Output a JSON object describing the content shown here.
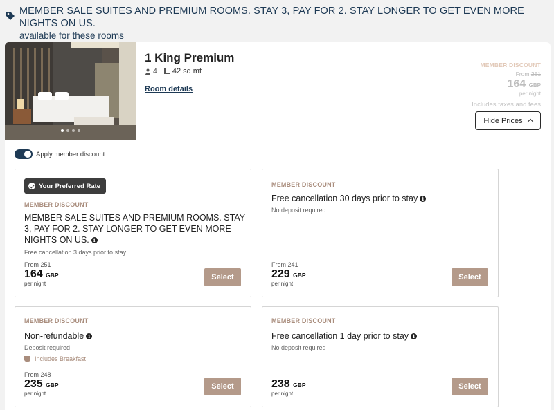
{
  "banner": {
    "icon": "tag-icon",
    "headline": "MEMBER SALE SUITES AND PREMIUM ROOMS. STAY 3, PAY FOR 2. STAY LONGER TO GET EVEN MORE NIGHTS ON US.",
    "subline": "available for these rooms"
  },
  "room": {
    "title": "1 King Premium",
    "guests": "4",
    "size": "42 sq mt",
    "details_link": "Room details",
    "carousel_dots": 4,
    "carousel_active": 1
  },
  "summary": {
    "label": "MEMBER DISCOUNT",
    "from_label": "From",
    "old_price": "251",
    "price": "164",
    "currency": "GBP",
    "per_night": "per night",
    "taxes_note": "Includes taxes and fees",
    "hide_prices": "Hide Prices"
  },
  "toggle": {
    "label": "Apply member discount",
    "on": true
  },
  "rates": [
    {
      "badge": "Your Preferred Rate",
      "discount_label": "MEMBER DISCOUNT",
      "title": "MEMBER SALE SUITES AND PREMIUM ROOMS. STAY 3, PAY FOR 2. STAY LONGER TO GET EVEN MORE NIGHTS ON US.",
      "sub": "Free cancellation 3 days prior to stay",
      "from_label": "From",
      "old_price": "251",
      "price": "164",
      "currency": "GBP",
      "per_night": "per night",
      "select": "Select"
    },
    {
      "discount_label": "MEMBER DISCOUNT",
      "title": "Free cancellation 30 days prior to stay",
      "sub": "No deposit required",
      "from_label": "From",
      "old_price": "241",
      "price": "229",
      "currency": "GBP",
      "per_night": "per night",
      "select": "Select"
    },
    {
      "discount_label": "MEMBER DISCOUNT",
      "title": "Non-refundable",
      "sub": "Deposit required",
      "perk": "Includes Breakfast",
      "from_label": "From",
      "old_price": "248",
      "price": "235",
      "currency": "GBP",
      "per_night": "per night",
      "select": "Select"
    },
    {
      "discount_label": "MEMBER DISCOUNT",
      "title": "Free cancellation 1 day prior to stay",
      "sub": "No deposit required",
      "price": "238",
      "currency": "GBP",
      "per_night": "per night",
      "select": "Select"
    }
  ],
  "colors": {
    "navy": "#1e3a55",
    "accent_tan": "#b49a8a",
    "discount_text": "#a98d7d",
    "badge_dark": "#3d3d3d",
    "page_bg": "#f2f2f2"
  }
}
